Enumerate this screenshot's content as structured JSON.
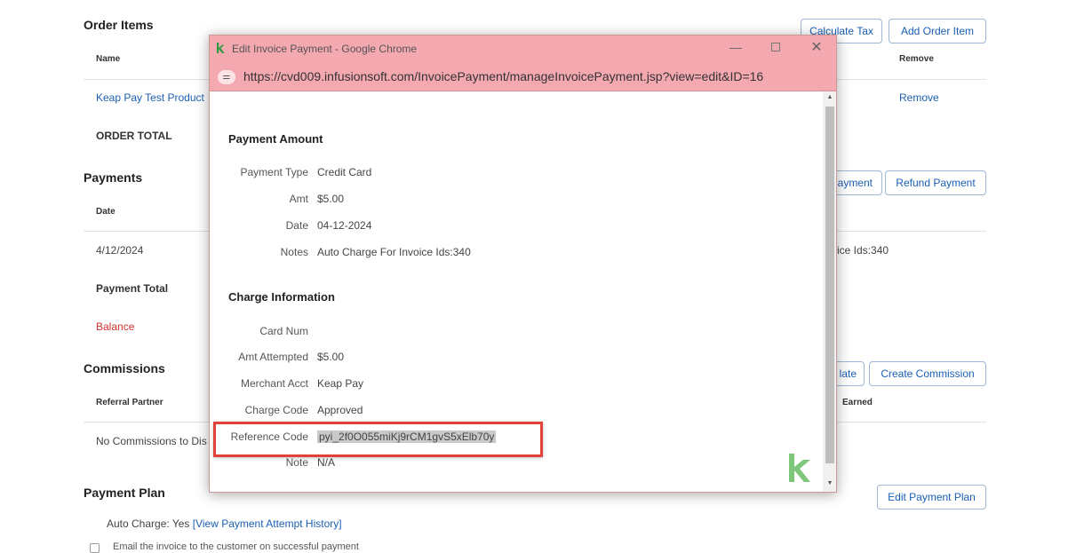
{
  "order_items": {
    "title": "Order Items",
    "calculate_tax_label": "Calculate Tax",
    "add_order_item_label": "Add Order Item",
    "col_name": "Name",
    "col_remove": "Remove",
    "row_product": "Keap Pay Test Product",
    "row_remove": "Remove",
    "order_total_label": "ORDER TOTAL"
  },
  "payments": {
    "title": "Payments",
    "add_payment_partial": "ayment",
    "refund_payment_label": "Refund Payment",
    "col_date": "Date",
    "row_date": "4/12/2024",
    "row_notes_partial": "ice Ids:340",
    "payment_total_label": "Payment Total",
    "balance_label": "Balance"
  },
  "commissions": {
    "title": "Commissions",
    "calculate_partial": "late",
    "create_commission_label": "Create Commission",
    "col_referral_partner": "Referral Partner",
    "col_earned": "Earned",
    "empty_partial": "No Commissions to Dis"
  },
  "payment_plan": {
    "title": "Payment Plan",
    "edit_label": "Edit Payment Plan",
    "auto_charge_prefix": "Auto Charge:  Yes",
    "view_history_label": "[View Payment Attempt History]",
    "email_partial": "Email the invoice to the customer on successful payment"
  },
  "popup": {
    "window_title": "Edit Invoice Payment - Google Chrome",
    "url": "https://cvd009.infusionsoft.com/InvoicePayment/manageInvoicePayment.jsp?view=edit&ID=16",
    "payment_amount_heading": "Payment Amount",
    "payment_type_label": "Payment Type",
    "payment_type_value": "Credit Card",
    "amt_label": "Amt",
    "amt_value": "$5.00",
    "date_label": "Date",
    "date_value": "04-12-2024",
    "notes_label": "Notes",
    "notes_value": "Auto Charge For Invoice Ids:340",
    "charge_info_heading": "Charge Information",
    "card_num_label": "Card Num",
    "card_num_value": "",
    "amt_attempted_label": "Amt Attempted",
    "amt_attempted_value": "$5.00",
    "merchant_acct_label": "Merchant Acct",
    "merchant_acct_value": "Keap Pay",
    "charge_code_label": "Charge Code",
    "charge_code_value": "Approved",
    "reference_code_label": "Reference Code",
    "reference_code_value": "pyi_2f0O055miKj9rCM1gvS5xElb70y",
    "note_label": "Note",
    "note_value": "N/A"
  },
  "colors": {
    "titlebar": "#f4a8b0",
    "link": "#1a5fb4",
    "highlight_border": "#e2413b",
    "keap_green": "#7dc67a"
  },
  "icons": [
    "keap-logo-icon",
    "minimize-icon",
    "maximize-icon",
    "close-icon",
    "site-settings-icon",
    "scroll-up-icon",
    "scroll-down-icon"
  ]
}
